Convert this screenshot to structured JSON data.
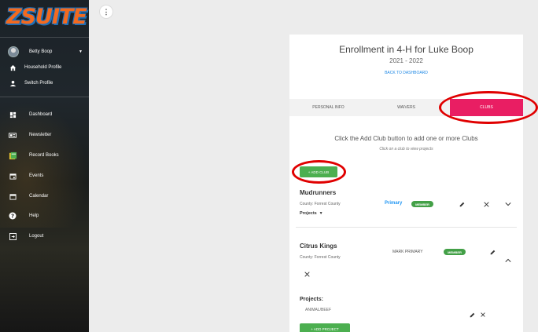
{
  "app": {
    "logo_text": "ZSUITE"
  },
  "sidebar": {
    "user": {
      "name": "Betty Boop"
    },
    "items": [
      {
        "label": "Household Profile",
        "icon": "home-icon"
      },
      {
        "label": "Switch Profile",
        "icon": "person-icon"
      },
      {
        "label": "Dashboard",
        "icon": "dashboard-icon"
      },
      {
        "label": "Newsletter",
        "icon": "newsletter-icon"
      },
      {
        "label": "Record Books",
        "icon": "record-books-icon"
      },
      {
        "label": "Events",
        "icon": "calendar-event-icon"
      },
      {
        "label": "Calendar",
        "icon": "calendar-icon"
      },
      {
        "label": "Help",
        "icon": "help-icon"
      },
      {
        "label": "Logout",
        "icon": "logout-icon"
      }
    ]
  },
  "enrollment": {
    "title": "Enrollment in 4-H for Luke Boop",
    "year": "2021 - 2022",
    "back_link": "BACK TO DASHBOARD",
    "tabs": [
      {
        "label": "PERSONAL INFO",
        "active": false
      },
      {
        "label": "WAIVERS",
        "active": false
      },
      {
        "label": "CLUBS",
        "active": true
      }
    ],
    "hint": "Click the Add Club button to add one or more Clubs",
    "subhint": "Click on a club to view projects",
    "add_club_label": "+ ADD CLUB",
    "clubs": [
      {
        "name": "Mudrunners",
        "county": "County: Forrest County",
        "primary_label": "Primary",
        "badge": "MEMBER",
        "projects_toggle": "Projects"
      },
      {
        "name": "Citrus Kings",
        "county": "County: Forrest County",
        "mark_primary_label": "MARK PRIMARY",
        "badge": "MEMBER"
      }
    ],
    "projects_heading": "Projects:",
    "project_items": [
      "ANIMAL/BEEF"
    ],
    "add_project_label": "+ ADD PROJECT"
  },
  "colors": {
    "accent": "#e91e63",
    "success": "#4caf50",
    "link": "#1e88e5",
    "annotation": "#e00000"
  }
}
